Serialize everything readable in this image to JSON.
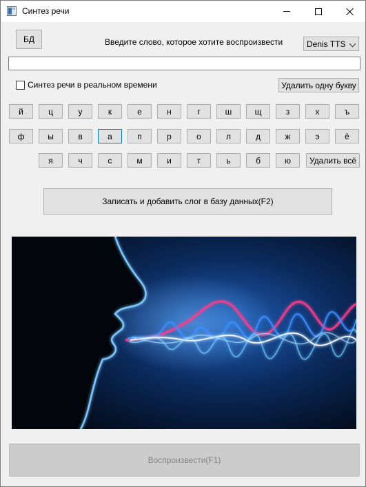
{
  "window": {
    "title": "Синтез речи",
    "icon": "app-window-icon",
    "controls": [
      "minimize-icon",
      "maximize-icon",
      "close-icon"
    ]
  },
  "toolbar": {
    "db_button": "БД",
    "prompt": "Введите слово, которое хотите воспроизвести",
    "voice_select": {
      "selected": "Denis TTS"
    }
  },
  "input": {
    "value": "",
    "placeholder": ""
  },
  "options": {
    "realtime_label": "Синтез речи в реальном времени",
    "realtime_checked": false,
    "delete_one_button": "Удалить одну букву"
  },
  "keyboard": {
    "row1": [
      "й",
      "ц",
      "у",
      "к",
      "е",
      "н",
      "г",
      "ш",
      "щ",
      "з",
      "х",
      "ъ"
    ],
    "row2": [
      "ф",
      "ы",
      "в",
      "а",
      "п",
      "р",
      "о",
      "л",
      "д",
      "ж",
      "э",
      "ё"
    ],
    "row3": [
      "я",
      "ч",
      "с",
      "м",
      "и",
      "т",
      "ь",
      "б",
      "ю"
    ],
    "delete_all_button": "Удалить всё"
  },
  "record_button": "Записать и добавить слог в базу данных(F2)",
  "play_button": "Воспроизвести(F1)",
  "image": {
    "subject": "speech-sound-waves-image"
  },
  "colors": {
    "window_bg": "#f0f0f0",
    "button_bg": "#e1e1e1",
    "button_border": "#adadad",
    "focus_border": "#0078d7",
    "disabled_text": "#838383",
    "wave_blue": "#3a8dff",
    "wave_pink": "#ff3c8a"
  }
}
